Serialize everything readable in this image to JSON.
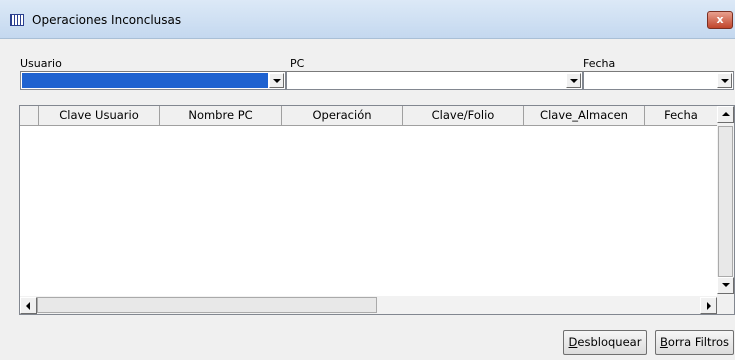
{
  "window": {
    "title": "Operaciones Inconclusas",
    "close_label": "x"
  },
  "filters": {
    "usuario_label": "Usuario",
    "pc_label": "PC",
    "fecha_label": "Fecha"
  },
  "grid": {
    "columns": [
      "Clave Usuario",
      "Nombre PC",
      "Operación",
      "Clave/Folio",
      "Clave_Almacen",
      "Fecha"
    ],
    "rows": []
  },
  "buttons": {
    "desbloquear_mnemonic": "D",
    "desbloquear_rest": "esbloquear",
    "borra_mnemonic": "B",
    "borra_rest": "orra Filtros"
  },
  "colors": {
    "selection": "#1e62d0",
    "close": "#c0452b"
  },
  "icons": {
    "app": "grid-window-icon",
    "close": "close-icon"
  }
}
